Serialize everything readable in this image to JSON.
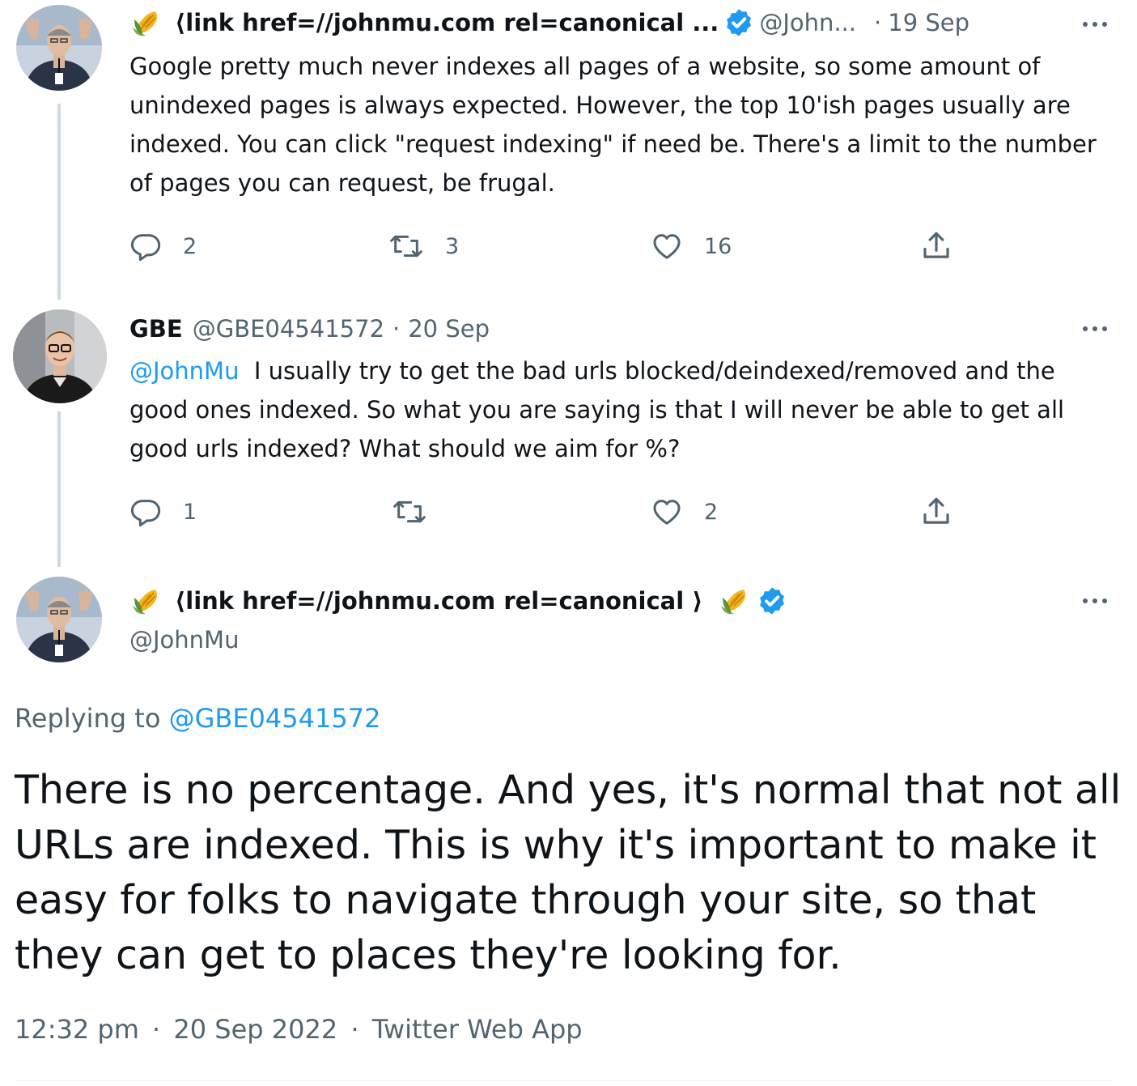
{
  "tweet1": {
    "name": "⟨link href=//johnmu.com rel=canonical ...",
    "handle": "@John...",
    "dot": "·",
    "time": "19 Sep",
    "text": "Google pretty much never indexes all pages of a website, so some amount of unindexed pages is always expected. However, the top 10'ish pages usually are indexed. You can click \"request indexing\" if need be. There's a limit to the number of pages you can request, be frugal.",
    "replies": "2",
    "retweets": "3",
    "likes": "16"
  },
  "tweet2": {
    "name": "GBE",
    "handle": "@GBE04541572",
    "dot": "·",
    "time": "20 Sep",
    "mention": "@JohnMu",
    "text": "I usually try to get the bad urls blocked/deindexed/removed and the good ones indexed. So what you are saying is that I will never be able to get all good urls indexed? What should we aim for %?",
    "replies": "1",
    "retweets": "",
    "likes": "2"
  },
  "tweet3": {
    "name": "⟨link href=//johnmu.com rel=canonical ⟩",
    "handle": "@JohnMu",
    "replying_label": "Replying to",
    "replying_to": "@GBE04541572",
    "text": "There is no percentage. And yes, it's normal that not all URLs are indexed. This is why it's important to make it easy for folks to navigate through your site, so that they can get to places they're looking for.",
    "time": "12:32 pm",
    "date": "20 Sep 2022",
    "source": "Twitter Web App",
    "dot": "·"
  },
  "icons": {
    "corn": "corn-emoji",
    "verified": "verified-badge-icon",
    "reply": "reply-icon",
    "retweet": "retweet-icon",
    "like": "heart-icon",
    "share": "share-icon",
    "more": "more-icon"
  },
  "colors": {
    "accent": "#1d9bf0",
    "muted": "#536471",
    "text": "#0f1419",
    "thread_line": "#cfd9de"
  }
}
